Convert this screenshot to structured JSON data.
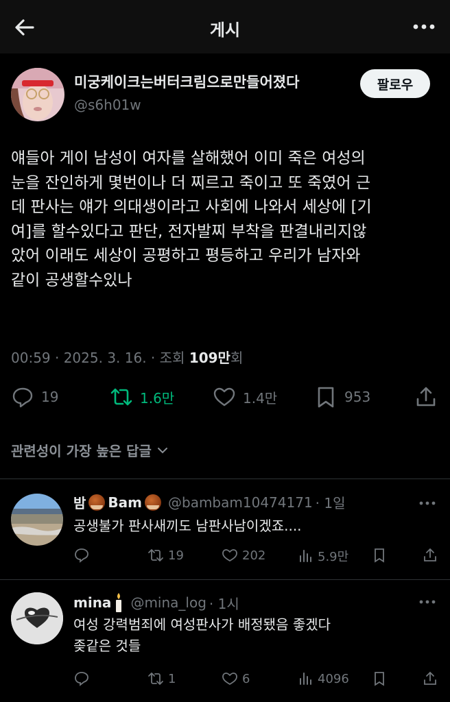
{
  "header": {
    "title": "게시"
  },
  "post": {
    "author_name": "미궁케이크는버터크림으로만들어졌다",
    "author_handle": "@s6h01w",
    "follow_label": "팔로우",
    "text_lines": [
      "얘들아 게이 남성이 여자를 살해했어 이미 죽은 여성의",
      "눈을 잔인하게 몇번이나 더 찌르고 죽이고 또 죽였어 근",
      "데 판사는 얘가 의대생이라고 사회에 나와서 세상에 [기",
      "여]를 할수있다고 판단, 전자발찌 부착을 판결내리지않",
      "았어 이래도 세상이 공평하고 평등하고 우리가 남자와",
      "같이 공생할수있나"
    ],
    "time": "00:59 · 2025. 3. 16. · 조회 ",
    "views": "109만",
    "views_suffix": "회",
    "replies": "19",
    "reposts": "1.6만",
    "likes": "1.4만",
    "bookmarks": "953"
  },
  "sort_label": "관련성이 가장 높은 답글",
  "replies": [
    {
      "name_prefix": "밤",
      "name_mid": "Bam",
      "handle": "@bambam10474171",
      "time": "· 1일",
      "text_lines": [
        "공생불가 판사새끼도 남판사남이겠죠...."
      ],
      "reposts": "19",
      "likes": "202",
      "views": "5.9만"
    },
    {
      "name": "mina",
      "handle": "@mina_log",
      "time": "· 1시",
      "text_lines": [
        "여성 강력범죄에 여성판사가 배정됐음 좋겠다",
        "좆같은 것들"
      ],
      "reposts": "1",
      "likes": "6",
      "views": "4096"
    }
  ],
  "colors": {
    "accent_repost": "#00ba7c",
    "muted": "#71767b",
    "text": "#e7e9ea"
  },
  "icons": [
    "back-arrow-icon",
    "more-icon",
    "reply-icon",
    "repost-icon",
    "like-icon",
    "bookmark-icon",
    "share-icon",
    "views-icon",
    "chevron-down-icon"
  ]
}
